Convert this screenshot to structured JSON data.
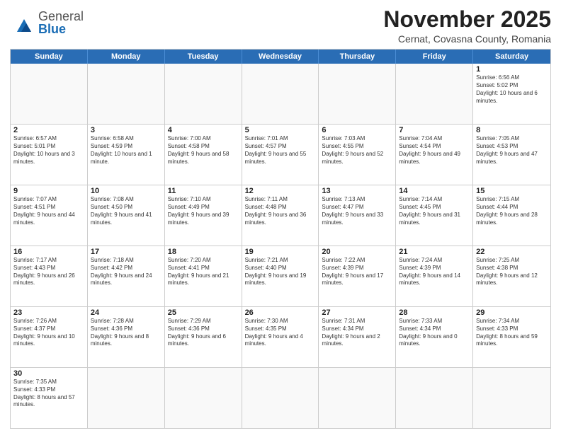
{
  "header": {
    "logo_general": "General",
    "logo_blue": "Blue",
    "title": "November 2025",
    "subtitle": "Cernat, Covasna County, Romania"
  },
  "weekdays": [
    "Sunday",
    "Monday",
    "Tuesday",
    "Wednesday",
    "Thursday",
    "Friday",
    "Saturday"
  ],
  "rows": [
    [
      {
        "day": "",
        "info": ""
      },
      {
        "day": "",
        "info": ""
      },
      {
        "day": "",
        "info": ""
      },
      {
        "day": "",
        "info": ""
      },
      {
        "day": "",
        "info": ""
      },
      {
        "day": "",
        "info": ""
      },
      {
        "day": "1",
        "info": "Sunrise: 6:56 AM\nSunset: 5:02 PM\nDaylight: 10 hours and 6 minutes."
      }
    ],
    [
      {
        "day": "2",
        "info": "Sunrise: 6:57 AM\nSunset: 5:01 PM\nDaylight: 10 hours and 3 minutes."
      },
      {
        "day": "3",
        "info": "Sunrise: 6:58 AM\nSunset: 4:59 PM\nDaylight: 10 hours and 1 minute."
      },
      {
        "day": "4",
        "info": "Sunrise: 7:00 AM\nSunset: 4:58 PM\nDaylight: 9 hours and 58 minutes."
      },
      {
        "day": "5",
        "info": "Sunrise: 7:01 AM\nSunset: 4:57 PM\nDaylight: 9 hours and 55 minutes."
      },
      {
        "day": "6",
        "info": "Sunrise: 7:03 AM\nSunset: 4:55 PM\nDaylight: 9 hours and 52 minutes."
      },
      {
        "day": "7",
        "info": "Sunrise: 7:04 AM\nSunset: 4:54 PM\nDaylight: 9 hours and 49 minutes."
      },
      {
        "day": "8",
        "info": "Sunrise: 7:05 AM\nSunset: 4:53 PM\nDaylight: 9 hours and 47 minutes."
      }
    ],
    [
      {
        "day": "9",
        "info": "Sunrise: 7:07 AM\nSunset: 4:51 PM\nDaylight: 9 hours and 44 minutes."
      },
      {
        "day": "10",
        "info": "Sunrise: 7:08 AM\nSunset: 4:50 PM\nDaylight: 9 hours and 41 minutes."
      },
      {
        "day": "11",
        "info": "Sunrise: 7:10 AM\nSunset: 4:49 PM\nDaylight: 9 hours and 39 minutes."
      },
      {
        "day": "12",
        "info": "Sunrise: 7:11 AM\nSunset: 4:48 PM\nDaylight: 9 hours and 36 minutes."
      },
      {
        "day": "13",
        "info": "Sunrise: 7:13 AM\nSunset: 4:47 PM\nDaylight: 9 hours and 33 minutes."
      },
      {
        "day": "14",
        "info": "Sunrise: 7:14 AM\nSunset: 4:45 PM\nDaylight: 9 hours and 31 minutes."
      },
      {
        "day": "15",
        "info": "Sunrise: 7:15 AM\nSunset: 4:44 PM\nDaylight: 9 hours and 28 minutes."
      }
    ],
    [
      {
        "day": "16",
        "info": "Sunrise: 7:17 AM\nSunset: 4:43 PM\nDaylight: 9 hours and 26 minutes."
      },
      {
        "day": "17",
        "info": "Sunrise: 7:18 AM\nSunset: 4:42 PM\nDaylight: 9 hours and 24 minutes."
      },
      {
        "day": "18",
        "info": "Sunrise: 7:20 AM\nSunset: 4:41 PM\nDaylight: 9 hours and 21 minutes."
      },
      {
        "day": "19",
        "info": "Sunrise: 7:21 AM\nSunset: 4:40 PM\nDaylight: 9 hours and 19 minutes."
      },
      {
        "day": "20",
        "info": "Sunrise: 7:22 AM\nSunset: 4:39 PM\nDaylight: 9 hours and 17 minutes."
      },
      {
        "day": "21",
        "info": "Sunrise: 7:24 AM\nSunset: 4:39 PM\nDaylight: 9 hours and 14 minutes."
      },
      {
        "day": "22",
        "info": "Sunrise: 7:25 AM\nSunset: 4:38 PM\nDaylight: 9 hours and 12 minutes."
      }
    ],
    [
      {
        "day": "23",
        "info": "Sunrise: 7:26 AM\nSunset: 4:37 PM\nDaylight: 9 hours and 10 minutes."
      },
      {
        "day": "24",
        "info": "Sunrise: 7:28 AM\nSunset: 4:36 PM\nDaylight: 9 hours and 8 minutes."
      },
      {
        "day": "25",
        "info": "Sunrise: 7:29 AM\nSunset: 4:36 PM\nDaylight: 9 hours and 6 minutes."
      },
      {
        "day": "26",
        "info": "Sunrise: 7:30 AM\nSunset: 4:35 PM\nDaylight: 9 hours and 4 minutes."
      },
      {
        "day": "27",
        "info": "Sunrise: 7:31 AM\nSunset: 4:34 PM\nDaylight: 9 hours and 2 minutes."
      },
      {
        "day": "28",
        "info": "Sunrise: 7:33 AM\nSunset: 4:34 PM\nDaylight: 9 hours and 0 minutes."
      },
      {
        "day": "29",
        "info": "Sunrise: 7:34 AM\nSunset: 4:33 PM\nDaylight: 8 hours and 59 minutes."
      }
    ],
    [
      {
        "day": "30",
        "info": "Sunrise: 7:35 AM\nSunset: 4:33 PM\nDaylight: 8 hours and 57 minutes."
      },
      {
        "day": "",
        "info": ""
      },
      {
        "day": "",
        "info": ""
      },
      {
        "day": "",
        "info": ""
      },
      {
        "day": "",
        "info": ""
      },
      {
        "day": "",
        "info": ""
      },
      {
        "day": "",
        "info": ""
      }
    ]
  ]
}
